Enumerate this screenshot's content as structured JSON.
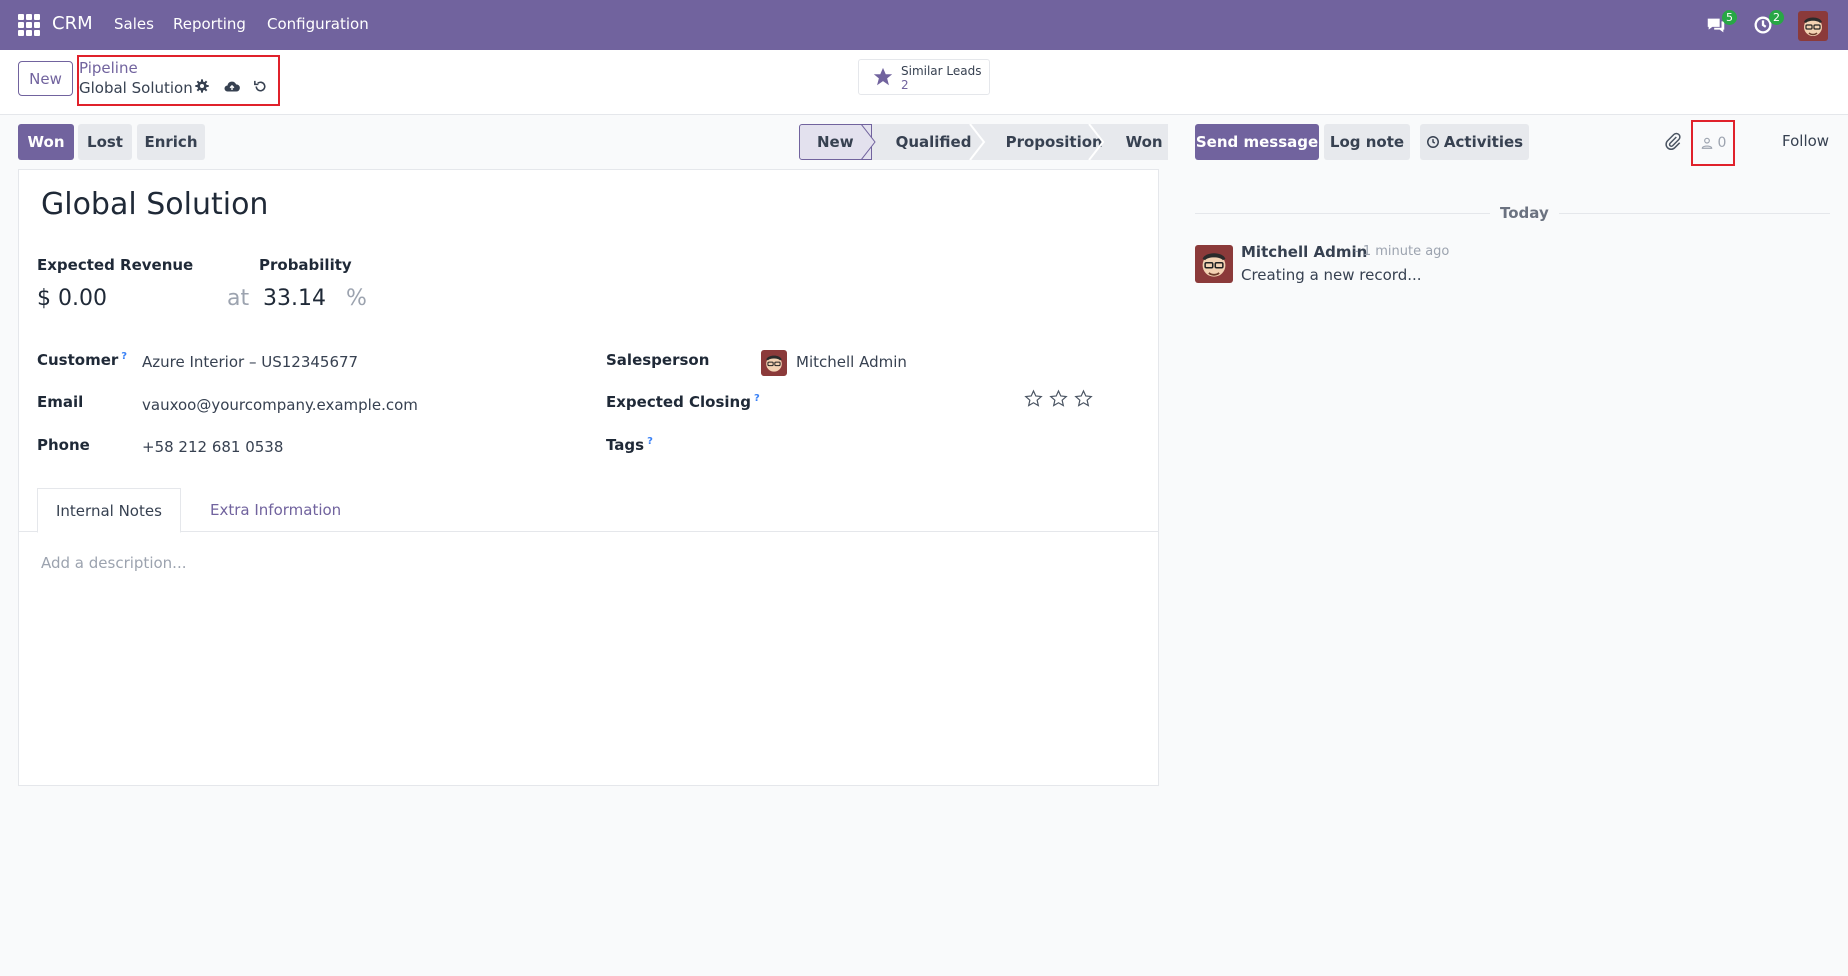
{
  "nav": {
    "brand": "CRM",
    "menu": [
      "Sales",
      "Reporting",
      "Configuration"
    ],
    "messages_count": "5",
    "activities_count": "2"
  },
  "control_panel": {
    "new_label": "New",
    "breadcrumb_parent": "Pipeline",
    "breadcrumb_current": "Global Solution",
    "similar_leads_label": "Similar Leads",
    "similar_leads_count": "2"
  },
  "actions": {
    "won": "Won",
    "lost": "Lost",
    "enrich": "Enrich"
  },
  "stages": [
    "New",
    "Qualified",
    "Proposition",
    "Won"
  ],
  "chatter": {
    "send_message": "Send message",
    "log_note": "Log note",
    "activities": "Activities",
    "followers_count": "0",
    "follow": "Follow",
    "separator": "Today",
    "message": {
      "author": "Mitchell Admin",
      "time": "- 1 minute ago",
      "body": "Creating a new record..."
    }
  },
  "form": {
    "title": "Global Solution",
    "expected_revenue_label": "Expected Revenue",
    "expected_revenue_value": "$ 0.00",
    "at": "at",
    "probability_label": "Probability",
    "probability_value": "33.14",
    "percent": "%",
    "customer_label": "Customer",
    "customer_value": "Azure Interior – US12345677",
    "email_label": "Email",
    "email_value": "vauxoo@yourcompany.example.com",
    "phone_label": "Phone",
    "phone_value": "+58 212 681 0538",
    "salesperson_label": "Salesperson",
    "salesperson_value": "Mitchell Admin",
    "expected_closing_label": "Expected Closing",
    "tags_label": "Tags",
    "help_mark": "?",
    "priority": {
      "stars_filled": 0,
      "stars_total": 3
    }
  },
  "tabs": {
    "internal_notes": "Internal Notes",
    "extra_information": "Extra Information",
    "description_placeholder": "Add a description..."
  },
  "colors": {
    "brand": "#71639e",
    "highlight_box": "#e0212b",
    "badge": "#28a745"
  }
}
